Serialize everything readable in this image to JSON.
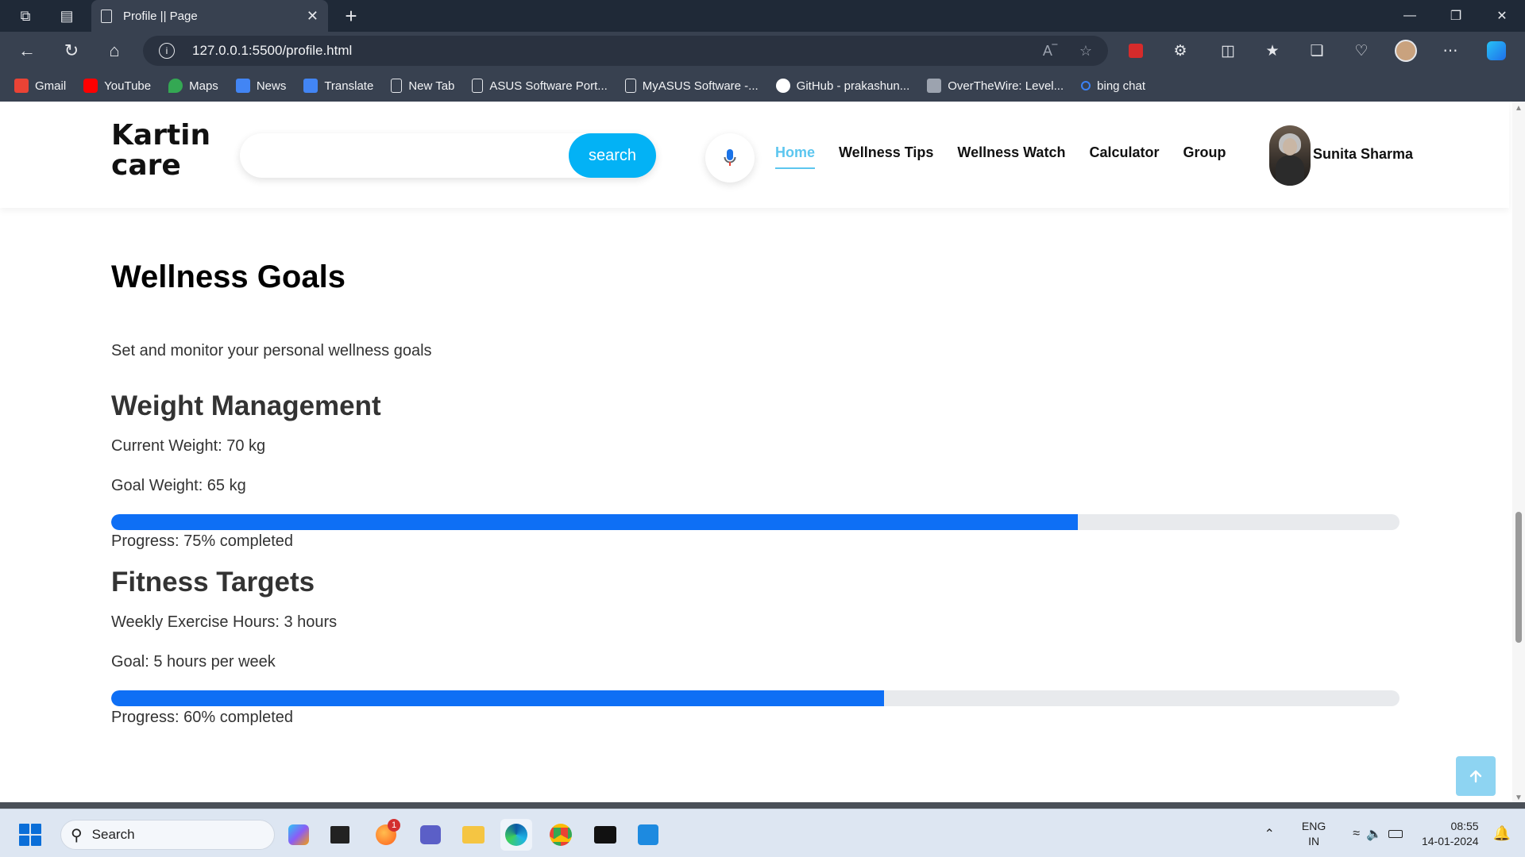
{
  "browser": {
    "tab_title": "Profile || Page",
    "url": "127.0.0.1:5500/profile.html",
    "bookmarks": [
      {
        "label": "Gmail",
        "icon": "gmail-icon",
        "color": "#ea4335"
      },
      {
        "label": "YouTube",
        "icon": "youtube-icon",
        "color": "#ff0000"
      },
      {
        "label": "Maps",
        "icon": "maps-icon",
        "color": "#34a853"
      },
      {
        "label": "News",
        "icon": "news-icon",
        "color": "#4285f4"
      },
      {
        "label": "Translate",
        "icon": "translate-icon",
        "color": "#4285f4"
      },
      {
        "label": "New Tab",
        "icon": "page-icon",
        "color": "#e5e7eb"
      },
      {
        "label": "ASUS Software Port...",
        "icon": "page-icon",
        "color": "#e5e7eb"
      },
      {
        "label": "MyASUS Software -...",
        "icon": "page-icon",
        "color": "#e5e7eb"
      },
      {
        "label": "GitHub - prakashun...",
        "icon": "github-icon",
        "color": "#ffffff"
      },
      {
        "label": "OverTheWire: Level...",
        "icon": "overthewire-icon",
        "color": "#9ca3af"
      },
      {
        "label": "bing chat",
        "icon": "bing-search-icon",
        "color": "#3b82f6"
      }
    ]
  },
  "header": {
    "logo_line1": "Kartin",
    "logo_line2": "care",
    "search_placeholder": "",
    "search_button": "search",
    "nav": [
      {
        "label": "Home",
        "active": true
      },
      {
        "label": "Wellness Tips",
        "active": false
      },
      {
        "label": "Wellness Watch",
        "active": false
      },
      {
        "label": "Calculator",
        "active": false
      },
      {
        "label": "Group",
        "active": false
      }
    ],
    "user_name": "Sunita Sharma"
  },
  "main": {
    "title": "Wellness Goals",
    "subtitle": "Set and monitor your personal wellness goals",
    "sections": [
      {
        "title": "Weight Management",
        "line1": "Current Weight: 70 kg",
        "line2": "Goal Weight: 65 kg",
        "progress_percent": 75,
        "progress_text": "Progress: 75% completed"
      },
      {
        "title": "Fitness Targets",
        "line1": "Weekly Exercise Hours: 3 hours",
        "line2": "Goal: 5 hours per week",
        "progress_percent": 60,
        "progress_text": "Progress: 60% completed"
      }
    ]
  },
  "taskbar": {
    "search_label": "Search",
    "notification_badge": "1",
    "language_line1": "ENG",
    "language_line2": "IN",
    "time": "08:55",
    "date": "14-01-2024"
  },
  "colors": {
    "accent": "#03b2f5",
    "nav_active": "#5cc6ef",
    "progress_fill": "#0e6ff5",
    "progress_track": "#e8eaed"
  }
}
